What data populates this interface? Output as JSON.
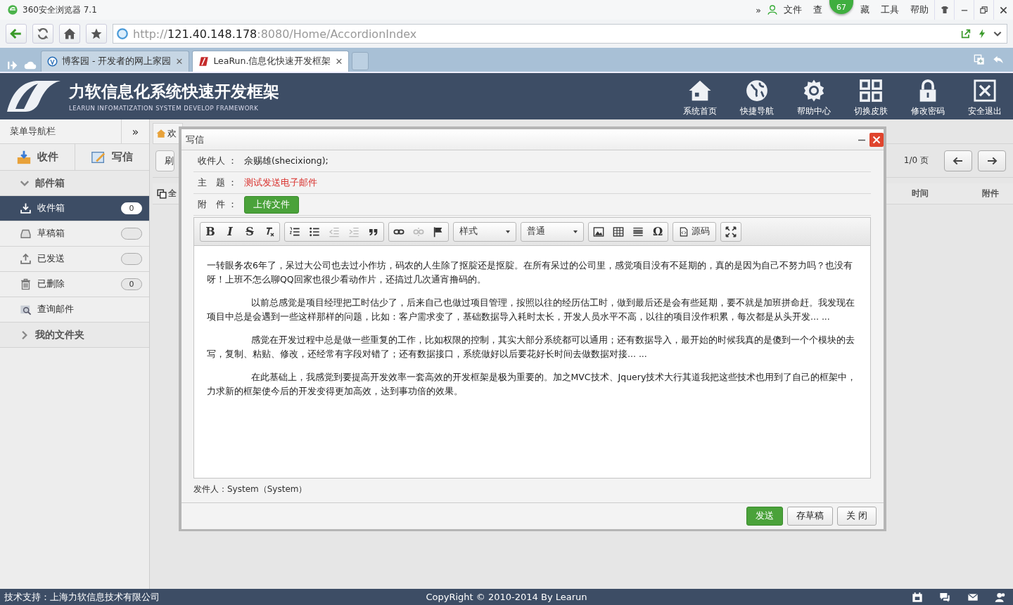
{
  "browser": {
    "title": "360安全浏览器 7.1",
    "more": "»",
    "menu": [
      {
        "label": "文件"
      },
      {
        "label": "查"
      },
      {
        "label": "藏"
      },
      {
        "label": "工具"
      },
      {
        "label": "帮助"
      }
    ],
    "badge": "67",
    "url": {
      "scheme": "http://",
      "host": "121.40.148.178",
      "path": ":8080/Home/AccordionIndex"
    },
    "tabs": [
      {
        "title": "博客园 - 开发者的网上家园",
        "close": "✕",
        "selected": false
      },
      {
        "title": "LeaRun.信息化快速开发框架",
        "close": "✕",
        "selected": true
      }
    ]
  },
  "app": {
    "title": "力软信息化系统快速开发框架",
    "subtitle": "LEARUN INFOMATIZATION SYSTEM DEVELOP FRAMEWORK",
    "nav": [
      {
        "label": "系统首页",
        "kind": "home"
      },
      {
        "label": "快捷导航",
        "kind": "globe"
      },
      {
        "label": "帮助中心",
        "kind": "gear"
      },
      {
        "label": "切换皮肤",
        "kind": "grid"
      },
      {
        "label": "修改密码",
        "kind": "lock"
      },
      {
        "label": "安全退出",
        "kind": "exit"
      }
    ]
  },
  "sidebar": {
    "title": "菜单导航栏",
    "collapse": "»",
    "actions": [
      {
        "label": "收件",
        "kind": "receive"
      },
      {
        "label": "写信",
        "kind": "compose"
      }
    ],
    "groups": [
      {
        "label": "邮件箱",
        "expanded": true,
        "items": [
          {
            "label": "收件箱",
            "kind": "inbox",
            "selected": true,
            "has_badge": true,
            "count": "0"
          },
          {
            "label": "草稿箱",
            "kind": "drafts",
            "selected": false,
            "has_badge": true
          },
          {
            "label": "已发送",
            "kind": "sent",
            "selected": false,
            "has_badge": true
          },
          {
            "label": "已删除",
            "kind": "trash",
            "selected": false,
            "has_badge": true,
            "count": "0"
          },
          {
            "label": "查询邮件",
            "kind": "search",
            "selected": false,
            "has_badge": false
          }
        ]
      },
      {
        "label": "我的文件夹",
        "expanded": false
      }
    ]
  },
  "main": {
    "tab": "欢",
    "refresh": "刷",
    "page_info": "1/0 页",
    "columns": [
      {
        "label": "全"
      },
      {
        "label": "时间"
      },
      {
        "label": "附件"
      }
    ]
  },
  "dialog": {
    "title": "写信",
    "fields": [
      {
        "label": "收件人 ：",
        "value": "佘赐雄(shecixiong);",
        "kind": "text"
      },
      {
        "label": "主　题 ：",
        "value": "测试发送电子邮件",
        "kind": "subject"
      },
      {
        "label": "附　件 ：",
        "value": "上传文件",
        "kind": "upload"
      }
    ],
    "toolbar": [
      [
        {
          "kind": "bold",
          "glyph": "B",
          "disabled": false
        },
        {
          "kind": "italic",
          "glyph": "I",
          "disabled": false
        },
        {
          "kind": "strike",
          "glyph": "S",
          "disabled": false
        },
        {
          "kind": "clearformat",
          "disabled": false
        }
      ],
      [
        {
          "kind": "olist",
          "disabled": false
        },
        {
          "kind": "ulist",
          "disabled": false
        },
        {
          "kind": "outdent",
          "disabled": true
        },
        {
          "kind": "indent",
          "disabled": true
        },
        {
          "kind": "quote",
          "disabled": false
        }
      ],
      [
        {
          "kind": "link",
          "disabled": false
        },
        {
          "kind": "unlink",
          "disabled": true
        },
        {
          "kind": "anchor",
          "disabled": false
        }
      ],
      [
        {
          "kind": "dropdown",
          "label": "样式",
          "disabled": false
        }
      ],
      [
        {
          "kind": "dropdown",
          "label": "普通",
          "disabled": false
        }
      ],
      [
        {
          "kind": "image",
          "disabled": false
        },
        {
          "kind": "table",
          "disabled": false
        },
        {
          "kind": "rule",
          "disabled": false
        },
        {
          "kind": "special",
          "glyph": "Ω",
          "disabled": false
        }
      ],
      [
        {
          "kind": "source",
          "label": "源码",
          "disabled": false
        }
      ],
      [
        {
          "kind": "maximize",
          "disabled": false
        }
      ]
    ],
    "paragraphs": [
      {
        "text": "一转眼务农6年了，呆过大公司也去过小作坊，码农的人生除了抠腚还是抠腚。在所有呆过的公司里，感觉项目没有不延期的，真的是因为自己不努力吗？也没有呀！上班不怎么聊QQ回家也很少看动作片，还搞过几次通宵撸码的。",
        "indent": false
      },
      {
        "text": "以前总感觉是项目经理把工时估少了，后来自己也做过项目管理，按照以往的经历估工时，做到最后还是会有些延期，要不就是加班拼命赶。我发现在项目中总是会遇到一些这样那样的问题，比如：客户需求变了，基础数据导入耗时太长，开发人员水平不高，以往的项目没作积累，每次都是从头开发... ...",
        "indent": true
      },
      {
        "text": "感觉在开发过程中总是做一些重复的工作，比如权限的控制，其实大部分系统都可以通用；还有数据导入，最开始的时候我真的是傻到一个个模块的去写，复制、粘贴、修改，还经常有字段对错了；还有数据接口，系统做好以后要花好长时间去做数据对接... ...",
        "indent": true
      },
      {
        "text": "在此基础上，我感觉到要提高开发效率一套高效的开发框架是极为重要的。加之MVC技术、Jquery技术大行其道我把这些技术也用到了自己的框架中，力求新的框架使今后的开发变得更加高效，达到事功倍的效果。",
        "indent": true
      }
    ],
    "sender": "发件人：System（System）",
    "buttons": [
      {
        "label": "发送",
        "kind": "primary"
      },
      {
        "label": "存草稿",
        "kind": "default"
      },
      {
        "label": "关 闭",
        "kind": "default"
      }
    ]
  },
  "footer": {
    "support": "技术支持：上海力软信息技术有限公司",
    "copyright": "CopyRight © 2010-2014 By Learun"
  }
}
